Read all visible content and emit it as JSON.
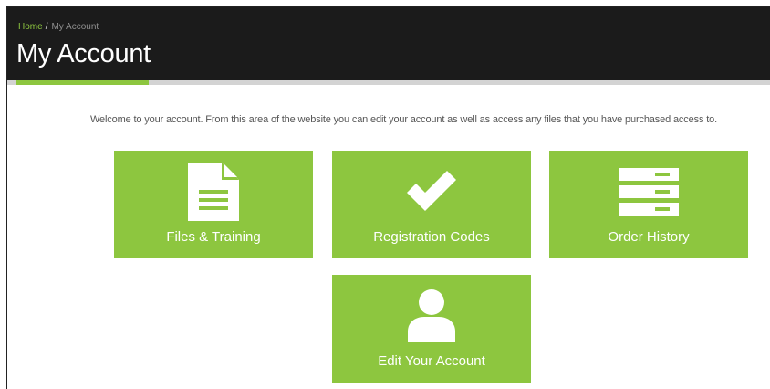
{
  "breadcrumb": {
    "home": "Home",
    "separator": "/",
    "current": "My Account"
  },
  "page": {
    "title": "My Account",
    "welcome": "Welcome to your account. From this area of the website you can edit your account as well as access any files that you have purchased access to."
  },
  "tiles": [
    {
      "label": "Files & Training",
      "icon": "document-icon"
    },
    {
      "label": "Registration Codes",
      "icon": "checkmark-icon"
    },
    {
      "label": "Order History",
      "icon": "server-stack-icon"
    },
    {
      "label": "Edit Your Account",
      "icon": "user-icon"
    }
  ],
  "colors": {
    "header_bg": "#1b1b1b",
    "accent_green": "#8dc63f",
    "divider_gray": "#d3d3d3",
    "body_text": "#555555"
  }
}
